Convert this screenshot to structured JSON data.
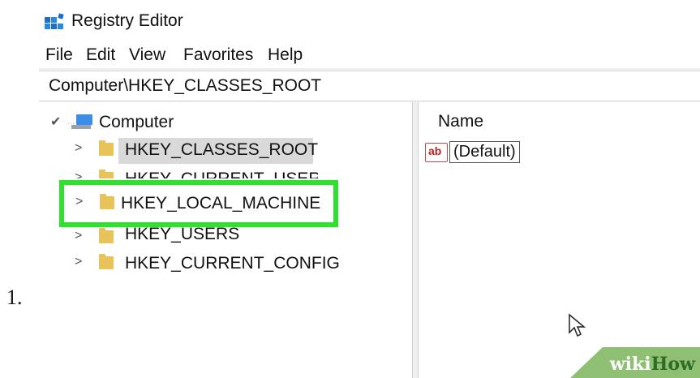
{
  "step": {
    "number": "1."
  },
  "window": {
    "title": "Registry Editor",
    "icon": "registry-editor-icon"
  },
  "menu": {
    "items": [
      {
        "label": "File"
      },
      {
        "label": "Edit"
      },
      {
        "label": "View"
      },
      {
        "label": "Favorites"
      },
      {
        "label": "Help"
      }
    ]
  },
  "address_bar": {
    "path": "Computer\\HKEY_CLASSES_ROOT"
  },
  "tree": {
    "root": {
      "label": "Computer",
      "expanded": true,
      "icon": "computer-icon"
    },
    "items": [
      {
        "label": "HKEY_CLASSES_ROOT",
        "selected": true
      },
      {
        "label": "HKEY_CURRENT_USER"
      },
      {
        "label": "HKEY_LOCAL_MACHINE",
        "highlighted": true
      },
      {
        "label": "HKEY_USERS"
      },
      {
        "label": "HKEY_CURRENT_CONFIG"
      }
    ]
  },
  "values_pane": {
    "column_name": "Name",
    "rows": [
      {
        "name": "(Default)",
        "icon": "string-value-icon",
        "icon_text": "ab"
      }
    ]
  },
  "watermark": {
    "part1": "wiki",
    "part2": "How"
  },
  "colors": {
    "highlight": "#2fe02f",
    "folder": "#e8c35a",
    "selected_row": "#d9d9d9"
  }
}
